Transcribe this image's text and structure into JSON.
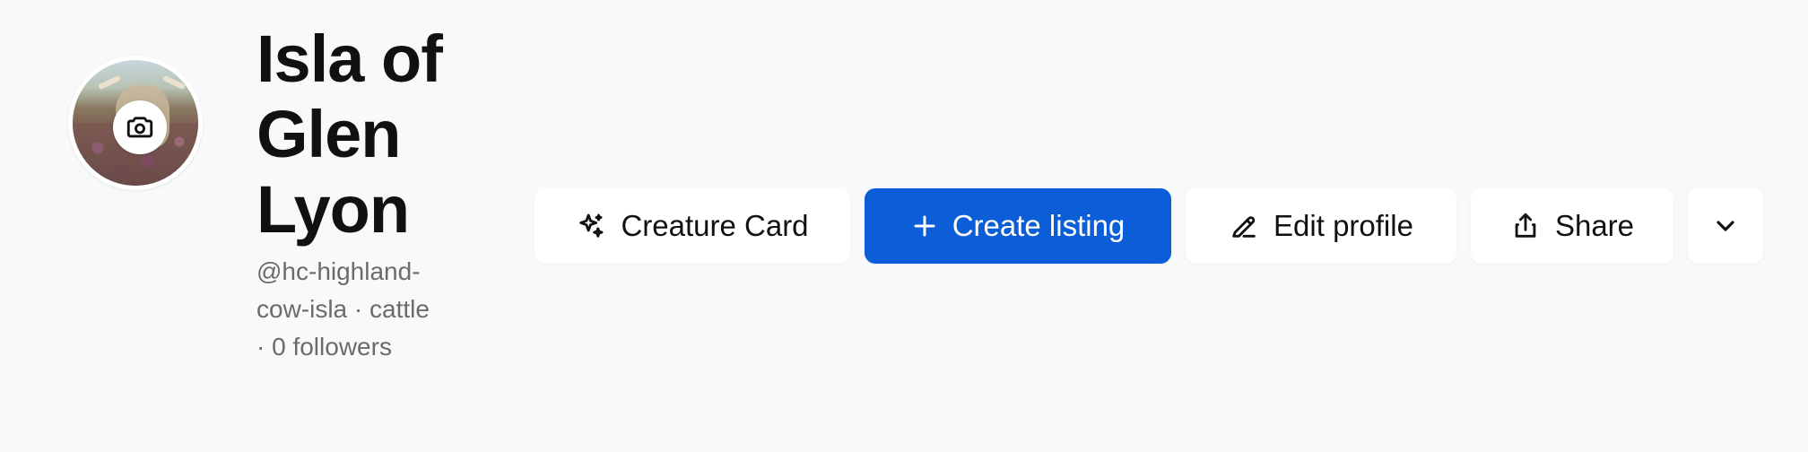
{
  "profile": {
    "name": "Isla of Glen Lyon",
    "meta": "@hc-highland-cow-isla · cattle · 0 followers"
  },
  "avatar": {
    "alt": "Highland cow on heather moorland",
    "camera_icon": "camera-icon"
  },
  "actions": {
    "creature_card": {
      "label": "Creature Card",
      "icon": "sparkle-icon"
    },
    "create_listing": {
      "label": "Create listing",
      "icon": "plus-icon"
    },
    "edit_profile": {
      "label": "Edit profile",
      "icon": "pencil-icon"
    },
    "share": {
      "label": "Share",
      "icon": "share-icon"
    },
    "more": {
      "icon": "chevron-down-icon"
    }
  },
  "colors": {
    "background": "#f8f9fb",
    "primary": "#0b5ed7",
    "text": "#111111",
    "muted": "#6b6b6b"
  }
}
